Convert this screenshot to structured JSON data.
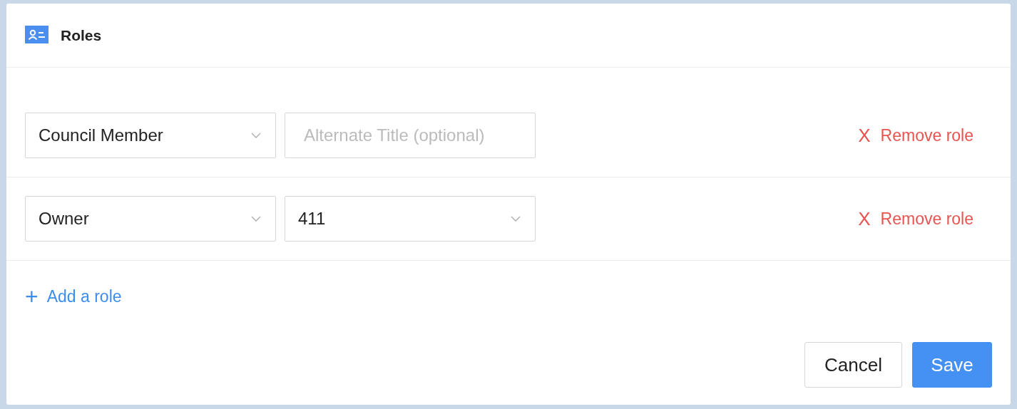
{
  "header": {
    "title": "Roles"
  },
  "roles": [
    {
      "role": "Council Member",
      "second": {
        "kind": "text",
        "placeholder": "Alternate Title (optional)"
      },
      "remove": "Remove role",
      "remove_icon": "X"
    },
    {
      "role": "Owner",
      "second": {
        "kind": "select",
        "value": "411"
      },
      "remove": "Remove role",
      "remove_icon": "X"
    }
  ],
  "add": {
    "icon": "+",
    "label": "Add a role"
  },
  "buttons": [
    {
      "kind": "secondary",
      "label": "Cancel"
    },
    {
      "kind": "primary",
      "label": "Save"
    }
  ]
}
